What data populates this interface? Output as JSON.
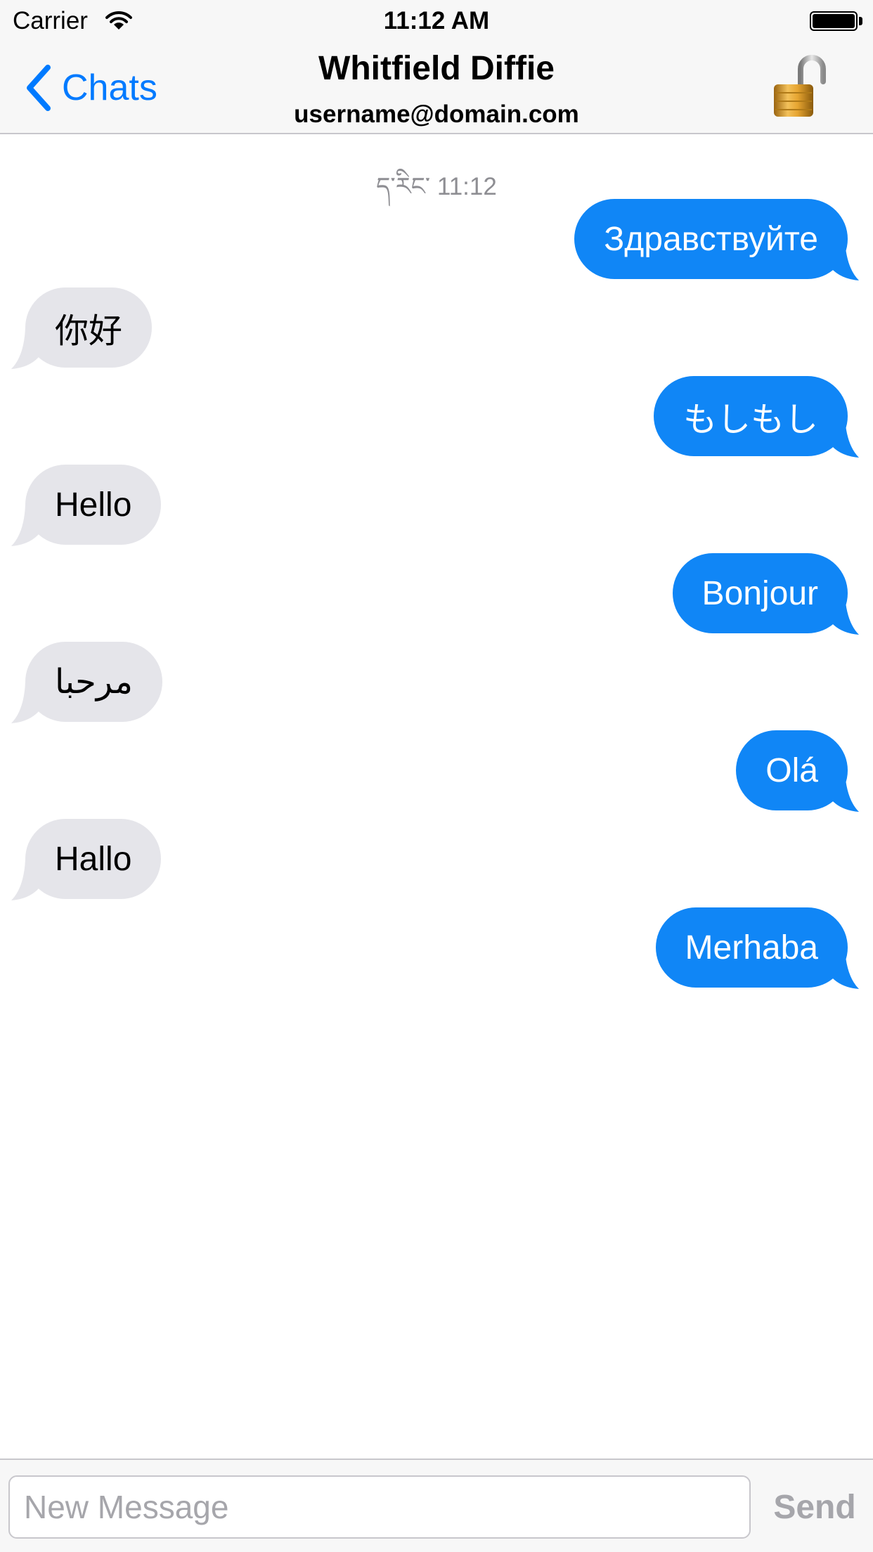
{
  "status_bar": {
    "carrier": "Carrier",
    "time": "11:12 AM",
    "wifi_icon": "wifi-icon",
    "battery_icon": "battery-full-icon"
  },
  "nav": {
    "back_label": "Chats",
    "back_icon": "chevron-left-icon",
    "title": "Whitfield Diffie",
    "subtitle": "username@domain.com",
    "lock_icon": "padlock-open-icon"
  },
  "conversation": {
    "timestamp": "ད་རིང་ 11:12",
    "messages": [
      {
        "direction": "outgoing",
        "text": "Здравствуйте"
      },
      {
        "direction": "incoming",
        "text": "你好"
      },
      {
        "direction": "outgoing",
        "text": "もしもし"
      },
      {
        "direction": "incoming",
        "text": "Hello"
      },
      {
        "direction": "outgoing",
        "text": "Bonjour"
      },
      {
        "direction": "incoming",
        "text": "مرحبا"
      },
      {
        "direction": "outgoing",
        "text": "Olá"
      },
      {
        "direction": "incoming",
        "text": "Hallo"
      },
      {
        "direction": "outgoing",
        "text": "Merhaba"
      }
    ]
  },
  "input_bar": {
    "placeholder": "New Message",
    "value": "",
    "send_label": "Send"
  },
  "colors": {
    "accent": "#007aff",
    "outgoing_bubble": "#1086f6",
    "incoming_bubble": "#e5e5ea",
    "disabled_text": "#a6a6ab"
  }
}
